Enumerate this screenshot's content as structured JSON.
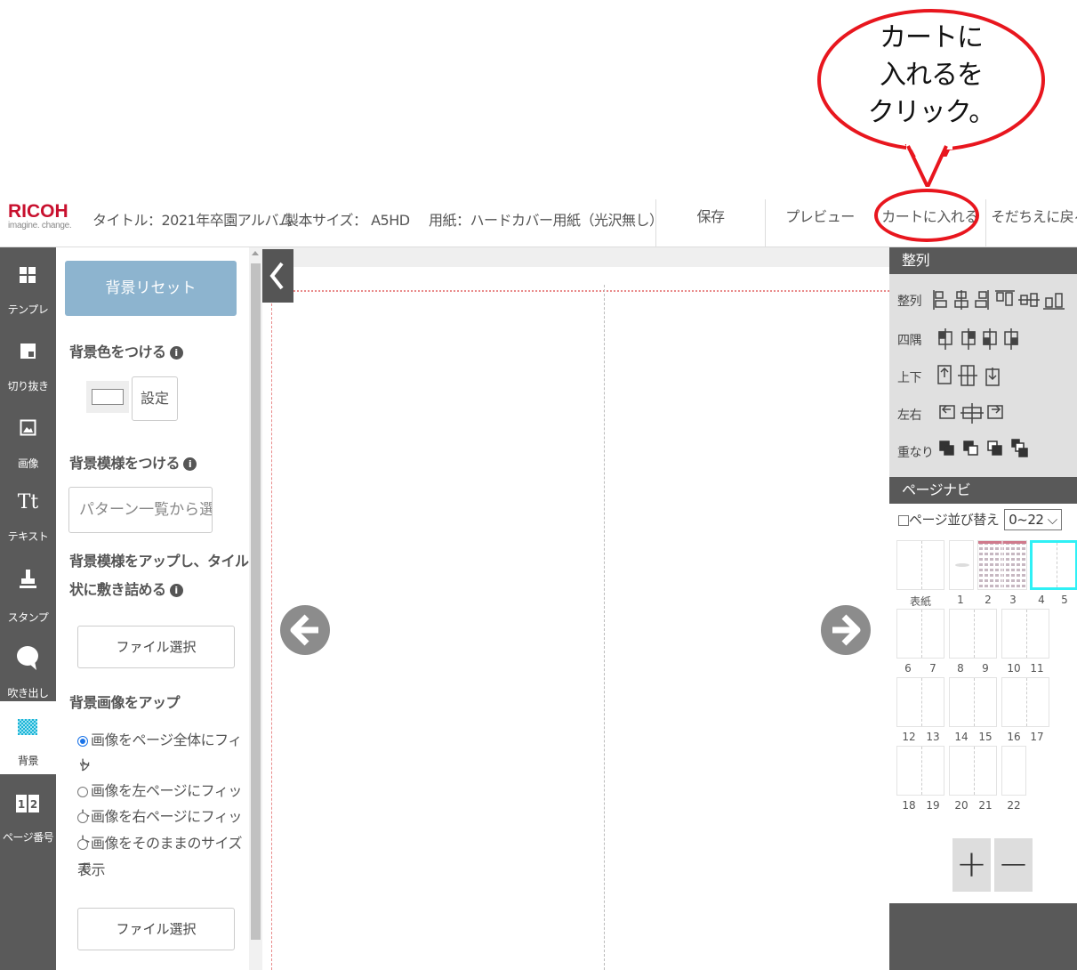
{
  "annotation": {
    "bubble_lines": [
      "カートに",
      "入れるを",
      "クリック。"
    ],
    "highlight_color": "#e8161e"
  },
  "header": {
    "logo": "RICOH",
    "logo_tagline": "imagine. change.",
    "title": "タイトル：2021年卒園アルバム",
    "size": "製本サイズ：  A5HD",
    "paper": "用紙：ハードカバー用紙（光沢無し）",
    "buttons": {
      "save": "保存",
      "preview": "プレビュー",
      "add_to_cart": "カートに入れる",
      "back": "そだちえに戻る"
    }
  },
  "sidebar": {
    "items": [
      {
        "icon": "template-icon",
        "label": "テンプレ"
      },
      {
        "icon": "crop-icon",
        "label": "切り抜き"
      },
      {
        "icon": "image-icon",
        "label": "画像"
      },
      {
        "icon": "text-icon",
        "label": "テキスト",
        "glyph": "Tt"
      },
      {
        "icon": "stamp-icon",
        "label": "スタンプ"
      },
      {
        "icon": "speech-bubble-icon",
        "label": "吹き出し"
      },
      {
        "icon": "background-icon",
        "label": "背景",
        "active": true
      },
      {
        "icon": "page-number-icon",
        "label": "ページ番号"
      }
    ]
  },
  "background_panel": {
    "reset_button": "背景リセット",
    "color_title": "背景色をつける",
    "set_button": "設定",
    "pattern_title": "背景模様をつける",
    "pattern_placeholder": "パターン一覧から選択",
    "tile_title_line1": "背景模様をアップし、タイル",
    "tile_title_line2": "状に敷き詰める",
    "file_button_1": "ファイル選択",
    "image_title": "背景画像をアップ",
    "fit_options": [
      {
        "label_line1": "画像をページ全体にフィッ",
        "label_line2": "ト",
        "selected": true
      },
      {
        "label_line1": "画像を左ページにフィット",
        "selected": false
      },
      {
        "label_line1": "画像を右ページにフィット",
        "selected": false
      },
      {
        "label_line1": "画像をそのままのサイズで",
        "label_line2": "表示",
        "selected": false
      }
    ],
    "file_button_2": "ファイル選択",
    "colors": {
      "reset_bg": "#8db4cf"
    }
  },
  "align_panel": {
    "title": "整列",
    "rows": [
      {
        "label": "整列",
        "icons": [
          "align-left-icon",
          "align-center-icon",
          "align-right-icon",
          "align-top-icon",
          "align-middle-icon",
          "align-bottom-icon"
        ]
      },
      {
        "label": "四隅",
        "icons": [
          "corner-top-left-icon",
          "corner-top-right-icon",
          "corner-bottom-left-icon",
          "corner-bottom-right-icon"
        ]
      },
      {
        "label": "上下",
        "icons": [
          "move-top-icon",
          "center-vertical-icon",
          "move-bottom-icon"
        ]
      },
      {
        "label": "左右",
        "icons": [
          "move-left-icon",
          "center-horizontal-icon",
          "move-right-icon"
        ]
      },
      {
        "label": "重なり",
        "icons": [
          "bring-front-icon",
          "bring-forward-icon",
          "send-backward-icon",
          "send-back-icon"
        ]
      }
    ]
  },
  "page_nav": {
    "title": "ページナビ",
    "sort_label": "ページ並び替え",
    "range_value": "0~22",
    "rows": [
      {
        "labels": [
          "表紙",
          "1",
          "2",
          "3",
          "4",
          "5"
        ]
      },
      {
        "labels": [
          "6",
          "7",
          "8",
          "9",
          "10",
          "11"
        ]
      },
      {
        "labels": [
          "12",
          "13",
          "14",
          "15",
          "16",
          "17"
        ]
      },
      {
        "labels": [
          "18",
          "19",
          "20",
          "21",
          "22"
        ]
      }
    ],
    "add_button": "+",
    "remove_button": "−",
    "selected_color": "#2ff0f5"
  }
}
